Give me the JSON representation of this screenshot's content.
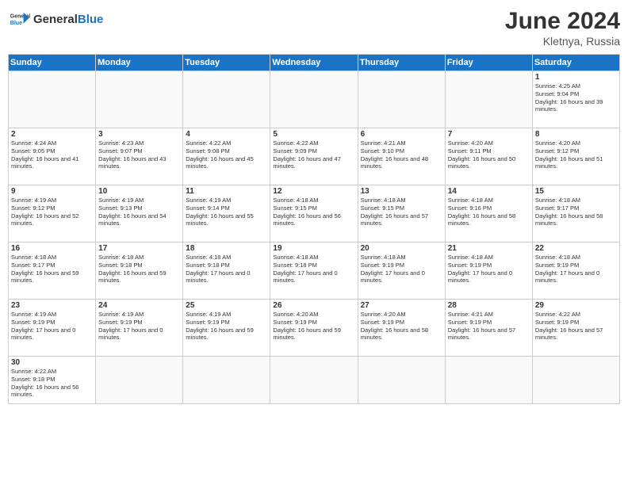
{
  "header": {
    "logo_general": "General",
    "logo_blue": "Blue",
    "month_title": "June 2024",
    "location": "Kletnya, Russia"
  },
  "weekdays": [
    "Sunday",
    "Monday",
    "Tuesday",
    "Wednesday",
    "Thursday",
    "Friday",
    "Saturday"
  ],
  "days": {
    "d1": {
      "num": "1",
      "sunrise": "Sunrise: 4:25 AM",
      "sunset": "Sunset: 9:04 PM",
      "daylight": "Daylight: 16 hours and 39 minutes."
    },
    "d2": {
      "num": "2",
      "sunrise": "Sunrise: 4:24 AM",
      "sunset": "Sunset: 9:05 PM",
      "daylight": "Daylight: 16 hours and 41 minutes."
    },
    "d3": {
      "num": "3",
      "sunrise": "Sunrise: 4:23 AM",
      "sunset": "Sunset: 9:07 PM",
      "daylight": "Daylight: 16 hours and 43 minutes."
    },
    "d4": {
      "num": "4",
      "sunrise": "Sunrise: 4:22 AM",
      "sunset": "Sunset: 9:08 PM",
      "daylight": "Daylight: 16 hours and 45 minutes."
    },
    "d5": {
      "num": "5",
      "sunrise": "Sunrise: 4:22 AM",
      "sunset": "Sunset: 9:09 PM",
      "daylight": "Daylight: 16 hours and 47 minutes."
    },
    "d6": {
      "num": "6",
      "sunrise": "Sunrise: 4:21 AM",
      "sunset": "Sunset: 9:10 PM",
      "daylight": "Daylight: 16 hours and 48 minutes."
    },
    "d7": {
      "num": "7",
      "sunrise": "Sunrise: 4:20 AM",
      "sunset": "Sunset: 9:11 PM",
      "daylight": "Daylight: 16 hours and 50 minutes."
    },
    "d8": {
      "num": "8",
      "sunrise": "Sunrise: 4:20 AM",
      "sunset": "Sunset: 9:12 PM",
      "daylight": "Daylight: 16 hours and 51 minutes."
    },
    "d9": {
      "num": "9",
      "sunrise": "Sunrise: 4:19 AM",
      "sunset": "Sunset: 9:12 PM",
      "daylight": "Daylight: 16 hours and 52 minutes."
    },
    "d10": {
      "num": "10",
      "sunrise": "Sunrise: 4:19 AM",
      "sunset": "Sunset: 9:13 PM",
      "daylight": "Daylight: 16 hours and 54 minutes."
    },
    "d11": {
      "num": "11",
      "sunrise": "Sunrise: 4:19 AM",
      "sunset": "Sunset: 9:14 PM",
      "daylight": "Daylight: 16 hours and 55 minutes."
    },
    "d12": {
      "num": "12",
      "sunrise": "Sunrise: 4:18 AM",
      "sunset": "Sunset: 9:15 PM",
      "daylight": "Daylight: 16 hours and 56 minutes."
    },
    "d13": {
      "num": "13",
      "sunrise": "Sunrise: 4:18 AM",
      "sunset": "Sunset: 9:15 PM",
      "daylight": "Daylight: 16 hours and 57 minutes."
    },
    "d14": {
      "num": "14",
      "sunrise": "Sunrise: 4:18 AM",
      "sunset": "Sunset: 9:16 PM",
      "daylight": "Daylight: 16 hours and 58 minutes."
    },
    "d15": {
      "num": "15",
      "sunrise": "Sunrise: 4:18 AM",
      "sunset": "Sunset: 9:17 PM",
      "daylight": "Daylight: 16 hours and 58 minutes."
    },
    "d16": {
      "num": "16",
      "sunrise": "Sunrise: 4:18 AM",
      "sunset": "Sunset: 9:17 PM",
      "daylight": "Daylight: 16 hours and 59 minutes."
    },
    "d17": {
      "num": "17",
      "sunrise": "Sunrise: 4:18 AM",
      "sunset": "Sunset: 9:18 PM",
      "daylight": "Daylight: 16 hours and 59 minutes."
    },
    "d18": {
      "num": "18",
      "sunrise": "Sunrise: 4:18 AM",
      "sunset": "Sunset: 9:18 PM",
      "daylight": "Daylight: 17 hours and 0 minutes."
    },
    "d19": {
      "num": "19",
      "sunrise": "Sunrise: 4:18 AM",
      "sunset": "Sunset: 9:18 PM",
      "daylight": "Daylight: 17 hours and 0 minutes."
    },
    "d20": {
      "num": "20",
      "sunrise": "Sunrise: 4:18 AM",
      "sunset": "Sunset: 9:19 PM",
      "daylight": "Daylight: 17 hours and 0 minutes."
    },
    "d21": {
      "num": "21",
      "sunrise": "Sunrise: 4:18 AM",
      "sunset": "Sunset: 9:19 PM",
      "daylight": "Daylight: 17 hours and 0 minutes."
    },
    "d22": {
      "num": "22",
      "sunrise": "Sunrise: 4:18 AM",
      "sunset": "Sunset: 9:19 PM",
      "daylight": "Daylight: 17 hours and 0 minutes."
    },
    "d23": {
      "num": "23",
      "sunrise": "Sunrise: 4:19 AM",
      "sunset": "Sunset: 9:19 PM",
      "daylight": "Daylight: 17 hours and 0 minutes."
    },
    "d24": {
      "num": "24",
      "sunrise": "Sunrise: 4:19 AM",
      "sunset": "Sunset: 9:19 PM",
      "daylight": "Daylight: 17 hours and 0 minutes."
    },
    "d25": {
      "num": "25",
      "sunrise": "Sunrise: 4:19 AM",
      "sunset": "Sunset: 9:19 PM",
      "daylight": "Daylight: 16 hours and 59 minutes."
    },
    "d26": {
      "num": "26",
      "sunrise": "Sunrise: 4:20 AM",
      "sunset": "Sunset: 9:19 PM",
      "daylight": "Daylight: 16 hours and 59 minutes."
    },
    "d27": {
      "num": "27",
      "sunrise": "Sunrise: 4:20 AM",
      "sunset": "Sunset: 9:19 PM",
      "daylight": "Daylight: 16 hours and 58 minutes."
    },
    "d28": {
      "num": "28",
      "sunrise": "Sunrise: 4:21 AM",
      "sunset": "Sunset: 9:19 PM",
      "daylight": "Daylight: 16 hours and 57 minutes."
    },
    "d29": {
      "num": "29",
      "sunrise": "Sunrise: 4:22 AM",
      "sunset": "Sunset: 9:19 PM",
      "daylight": "Daylight: 16 hours and 57 minutes."
    },
    "d30": {
      "num": "30",
      "sunrise": "Sunrise: 4:22 AM",
      "sunset": "Sunset: 9:18 PM",
      "daylight": "Daylight: 16 hours and 56 minutes."
    }
  }
}
